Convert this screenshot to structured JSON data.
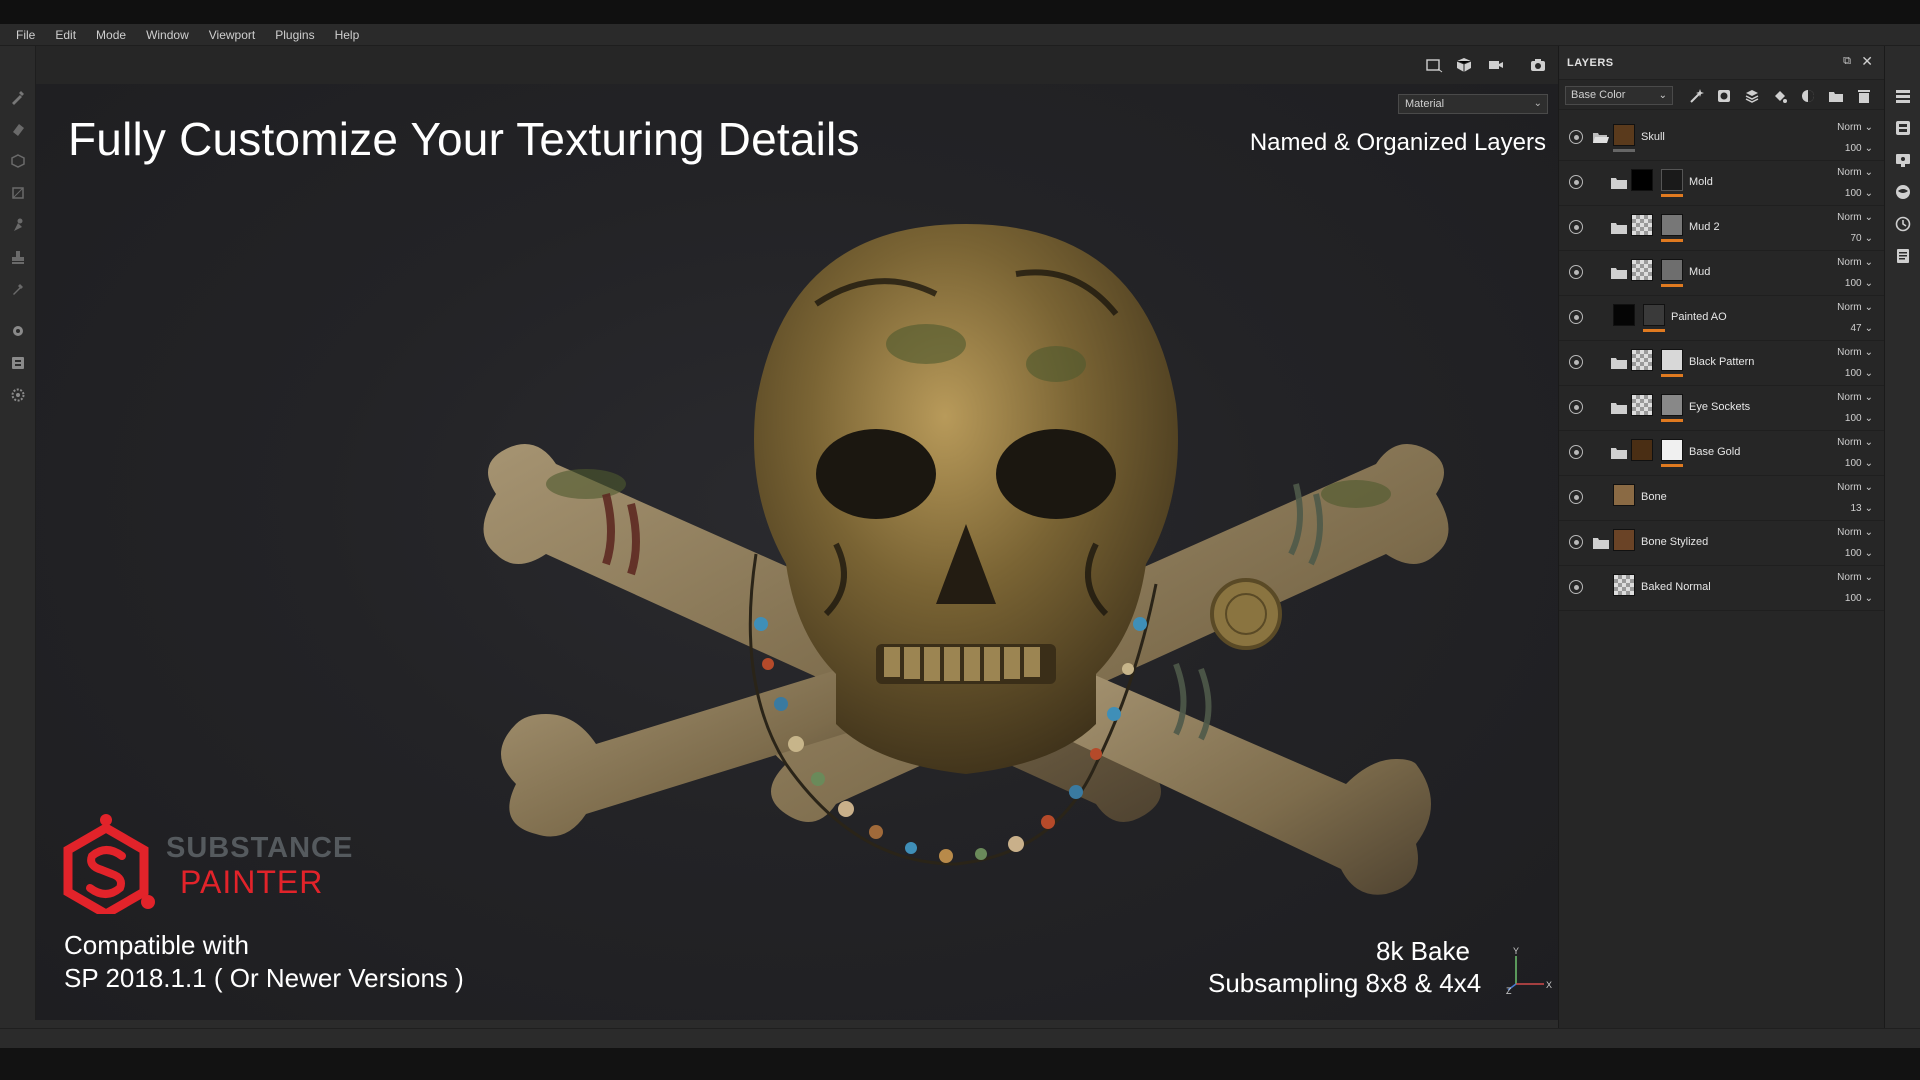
{
  "menu": [
    "File",
    "Edit",
    "Mode",
    "Window",
    "Viewport",
    "Plugins",
    "Help"
  ],
  "viewport": {
    "material_select": "Material",
    "headline": "Fully Customize Your Texturing Details",
    "subhead": "Named & Organized Layers",
    "logo_line1": "SUBSTANCE",
    "logo_line2": "PAINTER",
    "compat_line1": "Compatible with",
    "compat_line2": "SP 2018.1.1 ( Or Newer Versions )",
    "bake_line1": "8k Bake",
    "bake_line2": "Subsampling 8x8 & 4x4",
    "axis_y": "Y",
    "axis_x": "X",
    "axis_z": "Z"
  },
  "layers_panel": {
    "title": "LAYERS",
    "channel": "Base Color",
    "layers": [
      {
        "name": "Skull",
        "blend": "Norm",
        "opacity": "100"
      },
      {
        "name": "Mold",
        "blend": "Norm",
        "opacity": "100"
      },
      {
        "name": "Mud 2",
        "blend": "Norm",
        "opacity": "70"
      },
      {
        "name": "Mud",
        "blend": "Norm",
        "opacity": "100"
      },
      {
        "name": "Painted AO",
        "blend": "Norm",
        "opacity": "47"
      },
      {
        "name": "Black Pattern",
        "blend": "Norm",
        "opacity": "100"
      },
      {
        "name": "Eye Sockets",
        "blend": "Norm",
        "opacity": "100"
      },
      {
        "name": "Base Gold",
        "blend": "Norm",
        "opacity": "100"
      },
      {
        "name": "Bone",
        "blend": "Norm",
        "opacity": "13"
      },
      {
        "name": "Bone Stylized",
        "blend": "Norm",
        "opacity": "100"
      },
      {
        "name": "Baked Normal",
        "blend": "Norm",
        "opacity": "100"
      }
    ]
  },
  "colors": {
    "accent_orange": "#e07a20",
    "brand_red": "#e2232a",
    "panel_bg": "#262626"
  }
}
